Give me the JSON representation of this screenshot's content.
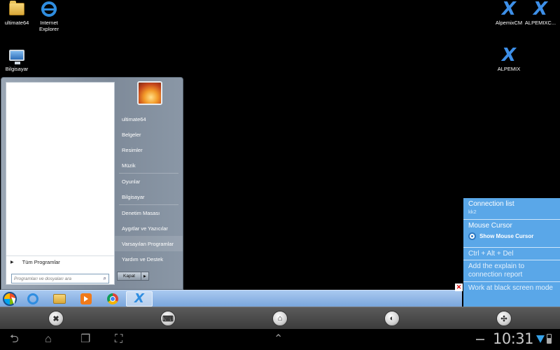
{
  "desktop": {
    "icons_left": [
      {
        "label": "ultimate64",
        "icon": "user-folder-icon"
      },
      {
        "label": "Internet Explorer",
        "icon": "internet-explorer-icon"
      },
      {
        "label": "Bilgisayar",
        "icon": "computer-icon"
      }
    ],
    "icons_right": [
      {
        "label": "AlpemixCM",
        "icon": "alpemix-icon"
      },
      {
        "label": "ALPEMIXC...",
        "icon": "alpemix-icon"
      },
      {
        "label": "ALPEMIX",
        "icon": "alpemix-icon"
      }
    ]
  },
  "start_menu": {
    "all_programs": "Tüm Programlar",
    "search_placeholder": "Programları ve dosyaları ara",
    "items": [
      "ultimate64",
      "Belgeler",
      "Resimler",
      "Müzik",
      "Oyunlar",
      "Bilgisayar",
      "Denetim Masası",
      "Aygıtlar ve Yazıcılar",
      "Varsayılan Programlar",
      "Yardım ve Destek"
    ],
    "shutdown_label": "Kapat"
  },
  "taskbar": {
    "items": [
      "internet-explorer-icon",
      "folder-icon",
      "media-player-icon",
      "chrome-icon",
      "alpemix-icon"
    ],
    "active_item": "alpemix-icon"
  },
  "side_panel": {
    "connection_list": "Connection list",
    "connection_sub": "kk2",
    "mouse_cursor": "Mouse Cursor",
    "show_mouse_cursor": "Show Mouse Cursor",
    "ctrl_alt_del": "Ctrl + Alt + Del",
    "explain": "Add the explain to connection report",
    "black_screen": "Work at black screen mode",
    "accent": "#5aa7e8"
  },
  "toolbar": {
    "buttons": [
      "close-icon",
      "keyboard-icon",
      "home-icon",
      "mouse-icon",
      "tools-icon"
    ]
  },
  "navbar": {
    "time": "10:31"
  }
}
